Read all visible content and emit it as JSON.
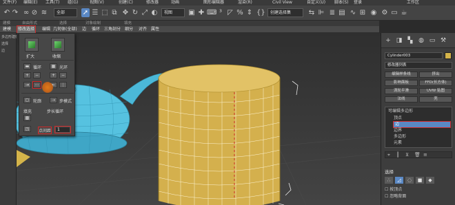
{
  "menubar": {
    "items": [
      "文件(F)",
      "编辑(E)",
      "工具(T)",
      "组(G)",
      "视图(V)",
      "创建(C)",
      "修改器",
      "动画",
      "图形编辑器",
      "渲染(R)",
      "Civil View",
      "自定义(U)",
      "脚本(S)",
      "工作区"
    ],
    "login": "登录",
    "workspace": "工作区"
  },
  "toolbar": {
    "filter_select": "全部",
    "view_select": "视图",
    "selset_select": "创建选择集"
  },
  "ribbon_top": [
    "建模",
    "自由形式",
    "选择",
    "对象绘制",
    "填充"
  ],
  "ribbon": {
    "items": [
      "建模",
      "修改选择",
      "编辑",
      "几何体(全部)",
      "边",
      "循环",
      "三角剖分",
      "细分",
      "对齐",
      "属性"
    ],
    "selected_index": 1
  },
  "leftstrip": [
    "多边形建模",
    "选择",
    "边"
  ],
  "floatpanel": {
    "grow_label": "扩大",
    "shrink_label": "收缩",
    "loop_label": "循环",
    "ring_label": "光环",
    "fill_label": "填充",
    "step_loop_label": "步长循环",
    "outline_label": "轮廓",
    "step_mode_label": "步模式",
    "point_gap_label": "点间距",
    "point_gap_value": "1"
  },
  "cmdpanel": {
    "tabs": [
      "+",
      "修改",
      "层次",
      "运动",
      "显示",
      "工具"
    ],
    "object_name": "Cylinder003",
    "modifier_list": "修改器列表",
    "buttons": [
      "编辑样条线",
      "挤出",
      "影响面板",
      "FFD(长方体)",
      "涡轮平滑",
      "UVW 贴图",
      "法线",
      "壳"
    ],
    "stack": {
      "root": "可编辑多边形",
      "items": [
        "顶点",
        "边",
        "边界",
        "多边形",
        "元素"
      ],
      "selected": "边"
    },
    "section_title": "选择",
    "options": [
      "按顶点",
      "忽略背面"
    ]
  }
}
